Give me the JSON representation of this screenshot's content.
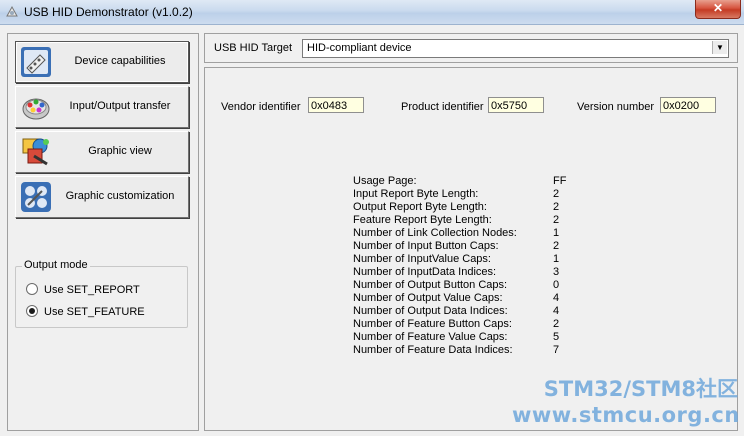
{
  "window": {
    "title": "USB HID Demonstrator (v1.0.2)",
    "close_glyph": "✕"
  },
  "nav": [
    {
      "label": "Device capabilities",
      "icon": "device-capabilities-icon",
      "active": true
    },
    {
      "label": "Input/Output transfer",
      "icon": "io-transfer-icon",
      "active": false
    },
    {
      "label": "Graphic view",
      "icon": "graphic-view-icon",
      "active": false
    },
    {
      "label": "Graphic customization",
      "icon": "graphic-customization-icon",
      "active": false
    }
  ],
  "output_mode": {
    "legend": "Output mode",
    "options": [
      {
        "label": "Use SET_REPORT",
        "checked": false
      },
      {
        "label": "Use SET_FEATURE",
        "checked": true
      }
    ]
  },
  "target": {
    "label": "USB HID Target",
    "value": "HID-compliant device"
  },
  "identifiers": {
    "vendor_label": "Vendor identifier",
    "vendor_value": "0x0483",
    "product_label": "Product identifier",
    "product_value": "0x5750",
    "version_label": "Version number",
    "version_value": "0x0200"
  },
  "capabilities": [
    {
      "label": "Usage Page:",
      "value": "FF"
    },
    {
      "label": "Input Report Byte Length:",
      "value": "2"
    },
    {
      "label": "Output Report Byte Length:",
      "value": "2"
    },
    {
      "label": "Feature Report Byte Length:",
      "value": "2"
    },
    {
      "label": "Number of Link Collection Nodes:",
      "value": "1"
    },
    {
      "label": "Number of Input Button Caps:",
      "value": "2"
    },
    {
      "label": "Number of InputValue Caps:",
      "value": "1"
    },
    {
      "label": "Number of InputData Indices:",
      "value": "3"
    },
    {
      "label": "Number of Output Button Caps:",
      "value": "0"
    },
    {
      "label": "Number of Output Value Caps:",
      "value": "4"
    },
    {
      "label": "Number of Output Data Indices:",
      "value": "4"
    },
    {
      "label": "Number of Feature Button Caps:",
      "value": "2"
    },
    {
      "label": "Number of Feature Value Caps:",
      "value": "5"
    },
    {
      "label": "Number of Feature Data Indices:",
      "value": "7"
    }
  ],
  "watermark": {
    "line1": "STM32/STM8社区",
    "line2": "www.stmcu.org.cn"
  }
}
